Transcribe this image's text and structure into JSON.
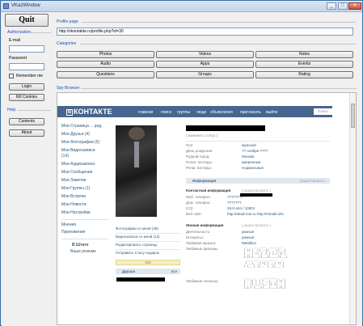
{
  "window": {
    "title": "VKazWindow"
  },
  "quit_label": "Quit",
  "auth": {
    "group": "Authorization",
    "email_label": "E-mail",
    "email_value": "",
    "password_label": "Password",
    "password_value": "",
    "remember_label": "Remember me",
    "login_label": "Login",
    "kill_cookies_label": "Kill Cookies"
  },
  "help": {
    "group": "Help",
    "contents_label": "Contents",
    "about_label": "About"
  },
  "profile": {
    "group": "Profile page",
    "url": "http://vkontakte.ru/profile.php?id=30"
  },
  "categories": {
    "group": "Categories",
    "items": [
      "Photos",
      "Videos",
      "Notes",
      "Audio",
      "Apps",
      "Events",
      "Questions",
      "Groups",
      "Rating"
    ]
  },
  "spy": {
    "group": "Spy Browser"
  },
  "vk": {
    "logo_mark": "В",
    "logo_text": "КОНТАКТЕ",
    "nav": [
      "главная",
      "поиск",
      "группы",
      "люди",
      "объявления",
      "пригласить",
      "выйти"
    ],
    "search_placeholder": "Поиск",
    "menu": [
      "Мои Страница ... ред.",
      "Мои Друзья (4)",
      "Мои Фотографии (5)",
      "Мои Видеозаписи",
      "(14)",
      "Мои Аудиозаписи",
      "Мои Сообщения",
      "Мои Заметки",
      "Мои Группы (1)",
      "Мои Встречи",
      "Мои Новости",
      "Мои Настройки"
    ],
    "menu2": [
      "Приложения"
    ],
    "menu3": "Мнения",
    "promo_title": "В Штате",
    "promo_sub": "Ваше резюме",
    "photo_links": [
      "Фотографии со мной (38)",
      "Видеозаписи со мной (14)",
      "Редактировать страницу",
      "Отправить Стасу подарок"
    ],
    "rating": "100",
    "friends_title": "Друзья",
    "friends_all": "все",
    "status_placeholder": "[ изменить статус ]",
    "info": [
      {
        "label": "Пол:",
        "value": "мужской"
      },
      {
        "label": "День рождения:",
        "value": "?? ноября ????"
      },
      {
        "label": "Родной город:",
        "value": "Москва"
      },
      {
        "label": "Полит. взгляды:",
        "value": "умеренные"
      },
      {
        "label": "Религ. взгляды:",
        "value": "Нормальные"
      }
    ],
    "section_info": "Информация",
    "section_info_edit": "редактировать",
    "contact_title": "Контактная информация",
    "contact_edit": "[ редактировать ]",
    "contact": [
      {
        "label": "Моб. телефон:",
        "value": "????????"
      },
      {
        "label": "Дом. телефон:",
        "value": "???????"
      },
      {
        "label": "ICQ:",
        "value": "33-0-444 / 10001"
      },
      {
        "label": "Веб-сайт:",
        "value": "http://dead-root.ru http://minabl.info"
      }
    ],
    "personal_title": "Личная информация",
    "personal_edit": "[ редактировать ]",
    "personal": [
      {
        "label": "Деятельность:",
        "value": "разные"
      },
      {
        "label": "Интересы:",
        "value": "разные"
      },
      {
        "label": "Любимая музыка:",
        "value": "Metallica"
      },
      {
        "label": "Любимые фильмы:",
        "value": ""
      }
    ],
    "fav_tv_label": "Любимые телешоу:"
  }
}
